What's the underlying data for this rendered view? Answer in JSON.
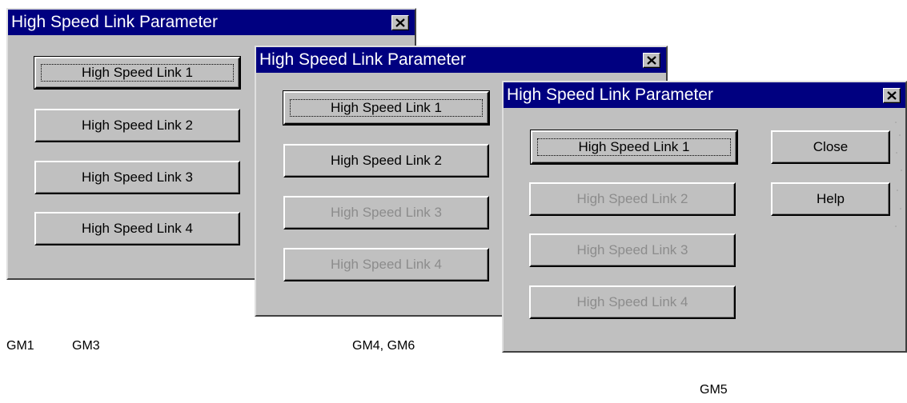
{
  "dialogs": [
    {
      "title": "High Speed Link Parameter",
      "buttons": [
        {
          "label": "High Speed Link 1",
          "state": "default"
        },
        {
          "label": "High Speed Link 2",
          "state": "enabled"
        },
        {
          "label": "High Speed Link 3",
          "state": "enabled"
        },
        {
          "label": "High Speed Link 4",
          "state": "enabled"
        }
      ]
    },
    {
      "title": "High Speed Link Parameter",
      "buttons": [
        {
          "label": "High Speed Link 1",
          "state": "default"
        },
        {
          "label": "High Speed Link 2",
          "state": "enabled"
        },
        {
          "label": "High Speed Link 3",
          "state": "disabled"
        },
        {
          "label": "High Speed Link 4",
          "state": "disabled"
        }
      ]
    },
    {
      "title": "High Speed Link Parameter",
      "buttons": [
        {
          "label": "High Speed Link 1",
          "state": "default"
        },
        {
          "label": "High Speed Link 2",
          "state": "disabled"
        },
        {
          "label": "High Speed Link 3",
          "state": "disabled"
        },
        {
          "label": "High Speed Link 4",
          "state": "disabled"
        }
      ],
      "close_label": "Close",
      "help_label": "Help"
    }
  ],
  "captions": {
    "gm1": "GM1",
    "gm3": "GM3",
    "gm4_gm6": "GM4, GM6",
    "gm5": "GM5"
  },
  "colors": {
    "title_bar": "#000080",
    "dialog_face": "#c0c0c0",
    "disabled_text": "#8c8c8c"
  },
  "icons": {
    "title_close": "close-icon"
  }
}
